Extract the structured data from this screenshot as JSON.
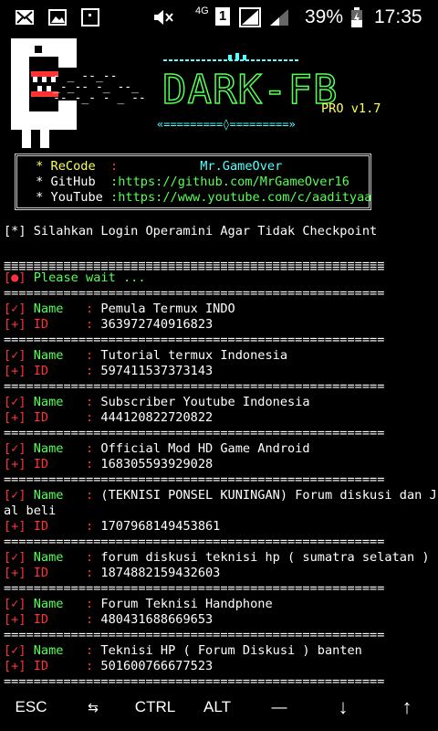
{
  "status_bar": {
    "network": "4G",
    "sim": "1",
    "battery_percent": "39%",
    "time": "17:35"
  },
  "logo": {
    "ascii_left": "- _ --_--\n_-_-- -_ --_\n-- -_- - _ --",
    "title": "DARK-FB",
    "version": "PRO v1.7",
    "underline": "«=========◊=========»"
  },
  "info": {
    "recode_label": " * ReCode  ",
    "recode_sep": ": ",
    "recode_value": "          Mr.GameOver",
    "github_label": " * GitHub  ",
    "github_sep": ":",
    "github_value": "https://github.com/MrGameOver16",
    "youtube_label": " * YouTube ",
    "youtube_sep": ":",
    "youtube_value": "https://www.youtube.com/c/aadityaa"
  },
  "notice": "[*] Silahkan Login Operamini Agar Tidak Checkpoint",
  "separator": "================================================================",
  "wait": {
    "bullet": "[●]",
    "text": " Please wait ..."
  },
  "labels": {
    "check": "[✓]",
    "plus": "[+]",
    "name": " Name   ",
    "id": " ID     ",
    "colon": ": "
  },
  "groups": [
    {
      "name": "Pemula Termux INDO",
      "id": "363972740916823"
    },
    {
      "name": "Tutorial termux Indonesia",
      "id": "597411537373143"
    },
    {
      "name": "Subscriber Youtube Indonesia",
      "id": "444120822720822"
    },
    {
      "name": "Official Mod HD Game Android",
      "id": "168305593929028"
    },
    {
      "name": "(TEKNISI PONSEL KUNINGAN) Forum diskusi dan Ju",
      "name_cont": "al beli",
      "id": "1707968149453861"
    },
    {
      "name": "forum diskusi teknisi hp ( sumatra selatan )",
      "id": "1874882159432603"
    },
    {
      "name": "Forum Teknisi Handphone",
      "id": "480431688669653"
    },
    {
      "name": "Teknisi HP ( Forum Diskusi ) banten",
      "id": "501600766677523"
    }
  ],
  "extra_keys": {
    "esc": "ESC",
    "tab": "⇆",
    "ctrl": "CTRL",
    "alt": "ALT",
    "dash": "—",
    "down": "↓",
    "up": "↑"
  }
}
